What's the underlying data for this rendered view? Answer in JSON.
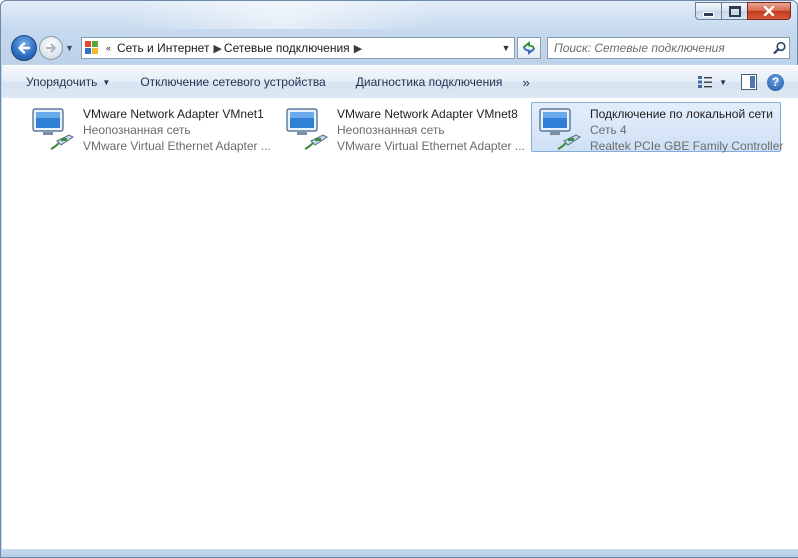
{
  "window": {
    "minimize_label": "minimize",
    "maximize_label": "maximize",
    "close_label": "close"
  },
  "address_bar": {
    "overflow_glyph": "«",
    "crumbs": [
      {
        "label": "Сеть и Интернет"
      },
      {
        "label": "Сетевые подключения"
      }
    ]
  },
  "search": {
    "placeholder": "Поиск: Сетевые подключения"
  },
  "command_bar": {
    "organize_label": "Упорядочить",
    "disable_label": "Отключение сетевого устройства",
    "diagnose_label": "Диагностика подключения",
    "more_label": "»"
  },
  "connections": [
    {
      "name": "VMware Network Adapter VMnet1",
      "status": "Неопознанная сеть",
      "device": "VMware Virtual Ethernet Adapter ...",
      "selected": false
    },
    {
      "name": "VMware Network Adapter VMnet8",
      "status": "Неопознанная сеть",
      "device": "VMware Virtual Ethernet Adapter ...",
      "selected": false
    },
    {
      "name": "Подключение по локальной сети",
      "status": "Сеть  4",
      "device": "Realtek PCIe GBE Family Controller",
      "selected": true
    }
  ],
  "colors": {
    "selection_bg": "#cfe0f5",
    "selection_border": "#84acdd",
    "link_text": "#1e3250"
  }
}
